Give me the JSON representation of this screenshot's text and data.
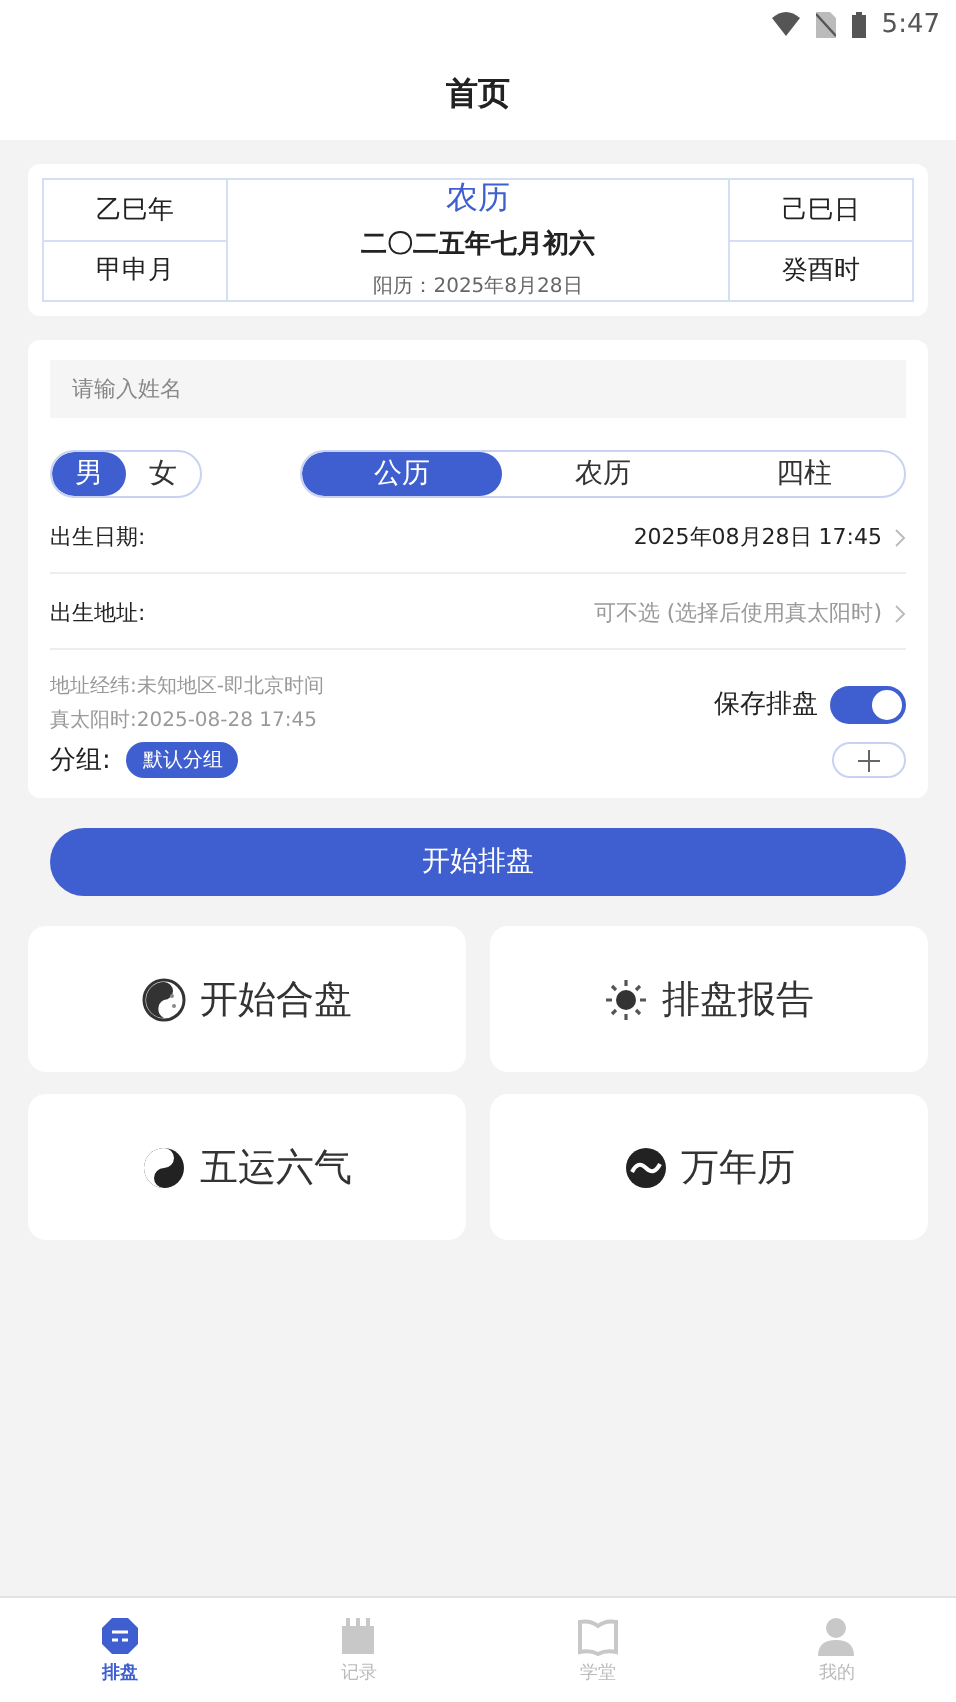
{
  "status_bar": {
    "time": "5:47"
  },
  "header": {
    "title": "首页"
  },
  "calendar": {
    "year_pillar": "乙巳年",
    "month_pillar": "甲申月",
    "day_pillar": "己巳日",
    "hour_pillar": "癸酉时",
    "heading": "农历",
    "lunar_date": "二〇二五年七月初六",
    "solar_date": "阳历：2025年8月28日"
  },
  "form": {
    "name_field": {
      "placeholder": "请输入姓名"
    },
    "gender": [
      {
        "label": "男",
        "selected": true
      },
      {
        "label": "女",
        "selected": false
      }
    ],
    "calendar_type": [
      {
        "label": "公历",
        "selected": true
      },
      {
        "label": "农历",
        "selected": false
      },
      {
        "label": "四柱",
        "selected": false
      }
    ],
    "rows": [
      {
        "label": "出生日期:",
        "value": "2025年08月28日 17:45",
        "placeholder": false
      },
      {
        "label": "出生地址:",
        "value": "可不选 (选择后使用真太阳时)",
        "placeholder": true
      }
    ],
    "location_info": "地址经纬:未知地区-即北京时间",
    "solar_time": "真太阳时:2025-08-28 17:45",
    "save": {
      "label": "保存排盘",
      "on": true
    },
    "group": {
      "label": "分组:",
      "tag": "默认分组"
    }
  },
  "start_button": "开始排盘",
  "tiles": [
    {
      "label": "开始合盘"
    },
    {
      "label": "排盘报告"
    },
    {
      "label": "五运六气"
    },
    {
      "label": "万年历"
    }
  ],
  "tab_bar": [
    {
      "label": "排盘",
      "selected": true
    },
    {
      "label": "记录",
      "selected": false
    },
    {
      "label": "学堂",
      "selected": false
    },
    {
      "label": "我的",
      "selected": false
    }
  ]
}
